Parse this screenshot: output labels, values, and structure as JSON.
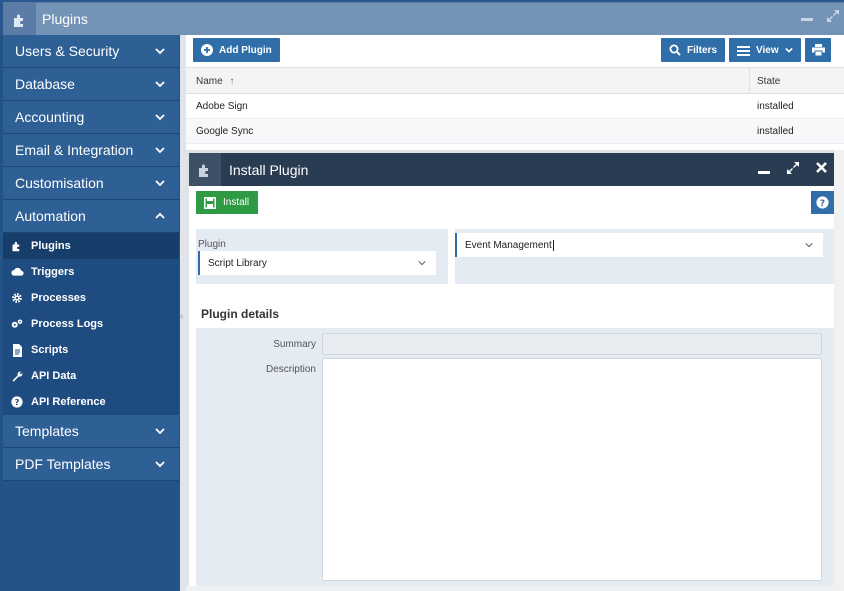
{
  "window": {
    "title": "Plugins",
    "icon": "puzzle-icon"
  },
  "sidebar": {
    "sections": [
      {
        "label": "Users & Security"
      },
      {
        "label": "Database"
      },
      {
        "label": "Accounting"
      },
      {
        "label": "Email & Integration"
      },
      {
        "label": "Customisation"
      },
      {
        "label": "Automation"
      }
    ],
    "automation_items": [
      {
        "label": "Plugins",
        "icon": "puzzle-icon"
      },
      {
        "label": "Triggers",
        "icon": "cloud-icon"
      },
      {
        "label": "Processes",
        "icon": "gear-icon"
      },
      {
        "label": "Process Logs",
        "icon": "gears-icon"
      },
      {
        "label": "Scripts",
        "icon": "document-icon"
      },
      {
        "label": "API Data",
        "icon": "wrench-icon"
      },
      {
        "label": "API Reference",
        "icon": "question-icon"
      }
    ],
    "bottom_sections": [
      {
        "label": "Templates"
      },
      {
        "label": "PDF Templates"
      }
    ]
  },
  "toolbar": {
    "add_plugin": "Add Plugin",
    "filters": "Filters",
    "view": "View"
  },
  "table": {
    "columns": [
      "Name",
      "State"
    ],
    "rows": [
      {
        "name": "Adobe Sign",
        "state": "installed"
      },
      {
        "name": "Google Sync",
        "state": "installed"
      }
    ]
  },
  "modal": {
    "title": "Install Plugin",
    "install": "Install",
    "plugin_label": "Plugin",
    "plugin_value": "Script Library",
    "secondary_value": "Event Management",
    "details_title": "Plugin details",
    "summary_label": "Summary",
    "description_label": "Description",
    "summary_value": "",
    "description_value": ""
  },
  "colors": {
    "accent": "#2f6ea8",
    "success": "#2f9a44",
    "sidebar": "#2e5f95",
    "modal_header": "#2a3c51"
  }
}
